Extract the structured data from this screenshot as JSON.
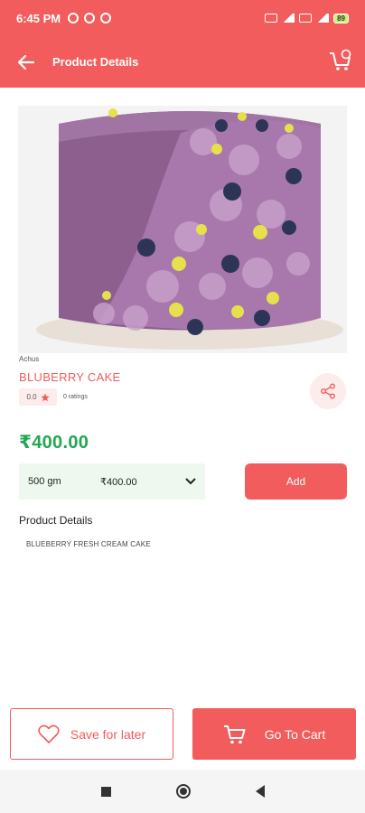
{
  "status_bar": {
    "time": "6:45 PM",
    "battery": "89"
  },
  "app_bar": {
    "title": "Product Details"
  },
  "product": {
    "brand": "Achus",
    "name": "BLUBERRY CAKE",
    "rating": "0.0",
    "rating_count": "0 ratings",
    "price": "₹400.00",
    "variant_weight": "500 gm",
    "variant_price": "₹400.00",
    "add_label": "Add",
    "details_heading": "Product Details",
    "details_text": "BLUEBERRY FRESH CREAM CAKE"
  },
  "bottom_bar": {
    "save_label": "Save for later",
    "cart_label": "Go To Cart"
  },
  "colors": {
    "accent": "#f35c5c",
    "price": "#1fa84f",
    "variant_bg": "#eef8ef"
  }
}
